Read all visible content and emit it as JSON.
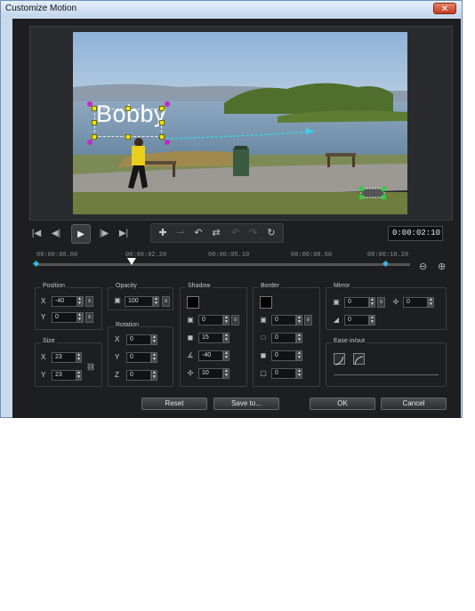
{
  "window": {
    "title": "Customize Motion",
    "close_glyph": "✕"
  },
  "preview": {
    "overlay_text": "Bobby"
  },
  "transport": {
    "icons": [
      "go-to-start-icon",
      "previous-frame-icon",
      "play-icon",
      "next-frame-icon",
      "go-to-end-icon"
    ],
    "glyphs": [
      "|◀",
      "◀|",
      "▶",
      "|▶",
      "▶|"
    ]
  },
  "keyframe_tools": {
    "icons": [
      "add-keyframe-icon",
      "remove-keyframe-icon",
      "reverse-keyframe-icon",
      "swap-keyframe-icon",
      "undo-icon",
      "redo-icon",
      "refresh-icon"
    ],
    "glyphs": [
      "✚",
      "⇀",
      "↶",
      "⇄",
      "↶",
      "↷",
      "↻"
    ]
  },
  "timecode": "0:00:02:10",
  "timeline": {
    "labels": [
      "00:00:00.00",
      "00:00:02.20",
      "00:00:05.10",
      "00:00:08.00",
      "00:00:10.20"
    ],
    "zoom_out_glyph": "⊖",
    "zoom_in_glyph": "⊕"
  },
  "position": {
    "title": "Position",
    "x_label": "X",
    "x_value": "-40",
    "y_label": "Y",
    "y_value": "0"
  },
  "size": {
    "title": "Size",
    "x_label": "X",
    "x_value": "23",
    "y_label": "Y",
    "y_value": "23"
  },
  "opacity": {
    "title": "Opacity",
    "value": "100"
  },
  "rotation": {
    "title": "Rotation",
    "x_label": "X",
    "x_value": "0",
    "y_label": "Y",
    "y_value": "0",
    "z_label": "Z",
    "z_value": "0"
  },
  "shadow": {
    "title": "Shadow",
    "color": "#000000",
    "opacity_value": "0",
    "blur_value": "15",
    "angle_value": "-40",
    "distance_value": "10"
  },
  "border": {
    "title": "Border",
    "color": "#000000",
    "opacity_value": "0",
    "width_value": "0",
    "blur_value": "0",
    "corner_value": "0"
  },
  "mirror": {
    "title": "Mirror",
    "opacity_value": "0",
    "distance_value": "0",
    "fade_value": "0"
  },
  "ease": {
    "title": "Ease in/out"
  },
  "buttons": {
    "reset": "Reset",
    "save_to": "Save to...",
    "ok": "OK",
    "cancel": "Cancel"
  }
}
